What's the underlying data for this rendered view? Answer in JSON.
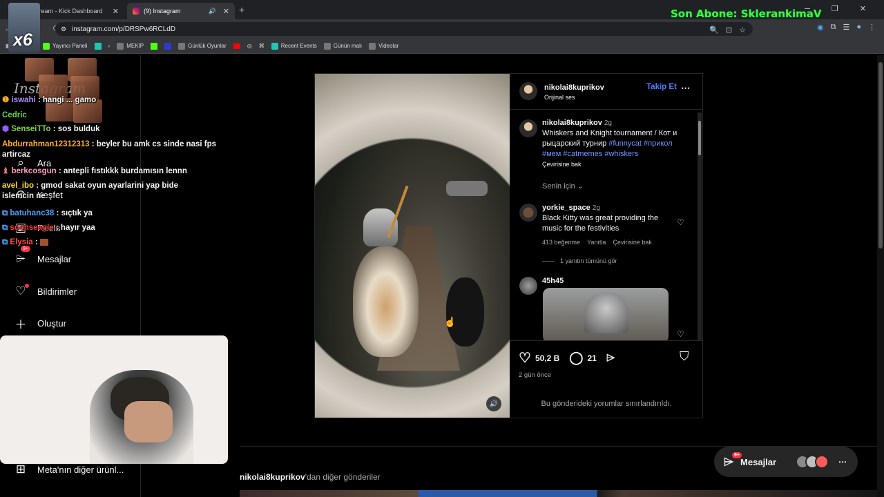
{
  "browser": {
    "tabs": [
      {
        "label": "Stream - Kick Dashboard",
        "active": false
      },
      {
        "label": "(9) Instagram",
        "active": true
      }
    ],
    "url": "instagram.com/p/DRSPw6RCLdD",
    "bookmarks": [
      "Yayıncı Paneli",
      "MEKİP",
      "Günlük Oyunlar",
      "Recent Events",
      "Günün malı",
      "Videolar"
    ]
  },
  "overlay": {
    "subscriber_label": "Son Abone: SklerankimaV",
    "multiplier": "x6"
  },
  "sidebar": {
    "logo": "Instagram",
    "items": [
      {
        "label": "Ara",
        "icon": "search-icon"
      },
      {
        "label": "Keşfet",
        "icon": "compass-icon"
      },
      {
        "label": "Reels",
        "icon": "reels-icon"
      },
      {
        "label": "Mesajlar",
        "icon": "messenger-icon",
        "badge": "9+"
      },
      {
        "label": "Bildirimler",
        "icon": "heart-icon"
      },
      {
        "label": "Oluştur",
        "icon": "plus-icon"
      },
      {
        "label": "Meta'nın diğer ürünl...",
        "icon": "grid-icon"
      }
    ]
  },
  "chat": [
    {
      "user": "iswahi",
      "text": "hangi ... gamo",
      "color": "#b38cff"
    },
    {
      "user": "Cedric",
      "text": "",
      "color": "#6fd14b"
    },
    {
      "user": "SenseiTTo",
      "text": "sos bulduk",
      "color": "#7fd14b"
    },
    {
      "user": "Abdurrahman12312313",
      "text": "beyler bu amk cs sinde nasi fps artircaz",
      "color": "#ffb020"
    },
    {
      "user": "berkcosgun",
      "text": "antepli fıstıkkk burdamısın lennn",
      "color": "#ff9ec1"
    },
    {
      "user": "avel_ibo",
      "text": "gmod sakat oyun ayarlarini yap bide islemcin ne",
      "color": "#ffdd33"
    },
    {
      "user": "batuhanc38",
      "text": "sıçtık ya",
      "color": "#4aa3ff"
    },
    {
      "user": "soonseagle",
      "text": "hayır yaa",
      "color": "#ff3a3a"
    },
    {
      "user": "Elysia",
      "text": "",
      "color": "#ff4a4a"
    }
  ],
  "post": {
    "author": "nikolai8kuprikov",
    "audio": "Orijinal ses",
    "follow_label": "Takip Et",
    "caption": {
      "user": "nikolai8kuprikov",
      "time": "2g",
      "text": "Whiskers and Knight tournament / Кот и рыцарский турнир",
      "tags": "#funnycat #прикол #мем #catmemes #whiskers",
      "translate": "Çevirisine bak"
    },
    "sort_label": "Senin için",
    "comments": [
      {
        "user": "yorkie_space",
        "time": "2g",
        "text": "Black Kitty was great providing the music for the festivities",
        "likes": "413 beğenme",
        "reply": "Yanıtla",
        "translate": "Çevirisine bak",
        "view_replies": "1 yanıtın tümünü gör"
      },
      {
        "user": "45h45"
      }
    ],
    "like_count": "50,2 B",
    "comment_count": "21",
    "posted": "2 gün önce",
    "restricted_note": "Bu gönderideki yorumlar sınırlandırıldı."
  },
  "more_posts": {
    "user": "nikolai8kuprikov",
    "suffix": "'dan diğer gönderiler"
  },
  "messages_bar": {
    "label": "Mesajlar",
    "badge": "9+"
  }
}
